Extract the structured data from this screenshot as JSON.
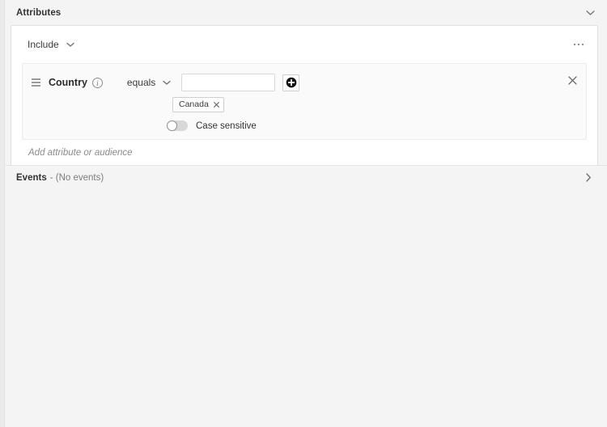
{
  "attributes": {
    "title": "Attributes",
    "collapse_icon": "chevron-down-icon",
    "include_selector": {
      "value": "Include",
      "icon": "chevron-down-icon"
    },
    "overflow_menu_icon": "kebab-menu-icon",
    "condition": {
      "drag_handle_icon": "drag-handle-icon",
      "attribute_name": "Country",
      "info_icon": "info-icon",
      "operator": {
        "value": "equals",
        "icon": "chevron-down-icon"
      },
      "value_input": {
        "value": "",
        "placeholder": ""
      },
      "add_value_button_icon": "add-circle-icon",
      "remove_button_icon": "close-icon",
      "tokens": [
        {
          "label": "Canada",
          "remove_icon": "close-icon"
        }
      ],
      "case_sensitive": {
        "label": "Case sensitive",
        "enabled": false
      }
    },
    "add_attribute_placeholder": "Add attribute or audience"
  },
  "events": {
    "title": "Events",
    "summary": "- (No events)",
    "expand_icon": "chevron-right-icon"
  },
  "colors": {
    "page_background": "#f4f4f4",
    "card_background": "#ffffff",
    "panel_background": "#fafafa",
    "border": "#e0e0e0",
    "text_primary": "#2c2c2c",
    "text_muted": "#8b8b8b",
    "accent_dark": "#000000"
  }
}
